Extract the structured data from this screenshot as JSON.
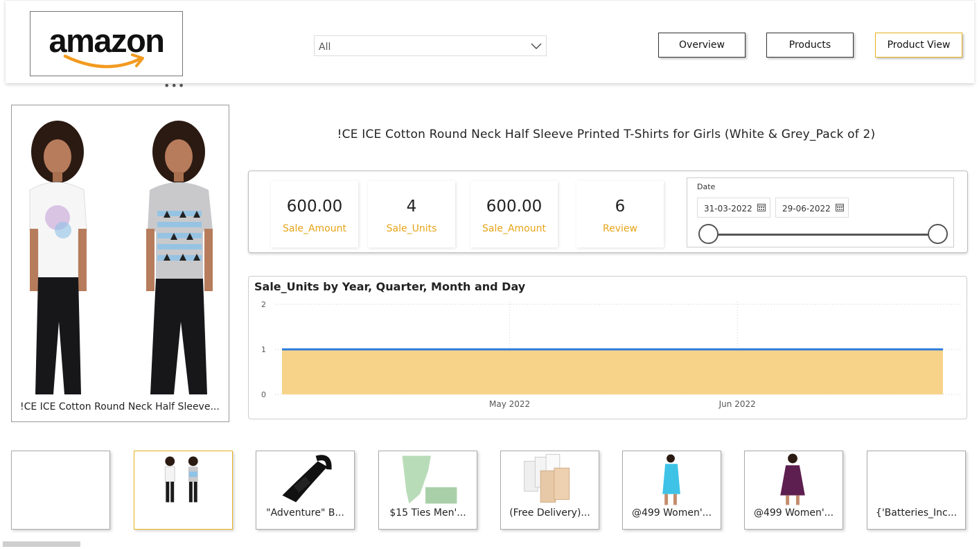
{
  "header": {
    "logo_text": "amazon",
    "slicer_value": "All",
    "nav": {
      "overview": "Overview",
      "products": "Products",
      "product_view": "Product View"
    }
  },
  "product": {
    "title": "!CE ICE Cotton Round Neck Half Sleeve Printed T-Shirts for Girls (White & Grey_Pack of 2)",
    "image_caption": "!CE ICE Cotton Round Neck Half Sleeve..."
  },
  "kpis": [
    {
      "value": "600.00",
      "label": "Sale_Amount"
    },
    {
      "value": "4",
      "label": "Sale_Units"
    },
    {
      "value": "600.00",
      "label": "Sale_Amount"
    },
    {
      "value": "6",
      "label": "Review"
    }
  ],
  "date_slicer": {
    "title": "Date",
    "start": "31-03-2022",
    "end": "29-06-2022"
  },
  "chart_data": {
    "type": "area",
    "title": "Sale_Units by Year, Quarter, Month and Day",
    "xlabel": "",
    "ylabel": "",
    "x_ticks": [
      "May 2022",
      "Jun 2022"
    ],
    "y_ticks": [
      0,
      1,
      2
    ],
    "ylim": [
      0,
      2
    ],
    "series": [
      {
        "values": [
          1,
          1
        ],
        "x": [
          "2022-03-31",
          "2022-06-29"
        ]
      }
    ],
    "colors": {
      "line": "#2b7bdb",
      "fill": "#f7d38a"
    },
    "grid": true
  },
  "thumbnails": [
    {
      "caption": "",
      "selected": false,
      "icon": "blank"
    },
    {
      "caption": "",
      "selected": true,
      "icon": "girls-tshirt-image"
    },
    {
      "caption": "\"Adventure\" B...",
      "selected": false,
      "icon": "belt-image"
    },
    {
      "caption": "$15 Ties Men'...",
      "selected": false,
      "icon": "tie-image"
    },
    {
      "caption": "(Free Delivery)...",
      "selected": false,
      "icon": "bra-extender-image"
    },
    {
      "caption": "@499 Women'...",
      "selected": false,
      "icon": "blue-dress-image"
    },
    {
      "caption": "@499 Women'...",
      "selected": false,
      "icon": "purple-dress-image"
    },
    {
      "caption": "{'Batteries_Inc...",
      "selected": false,
      "icon": "blank"
    }
  ],
  "colors": {
    "accent": "#e6a417",
    "selected_border": "#e8b21b",
    "logo_smile": "#f29a1f"
  }
}
